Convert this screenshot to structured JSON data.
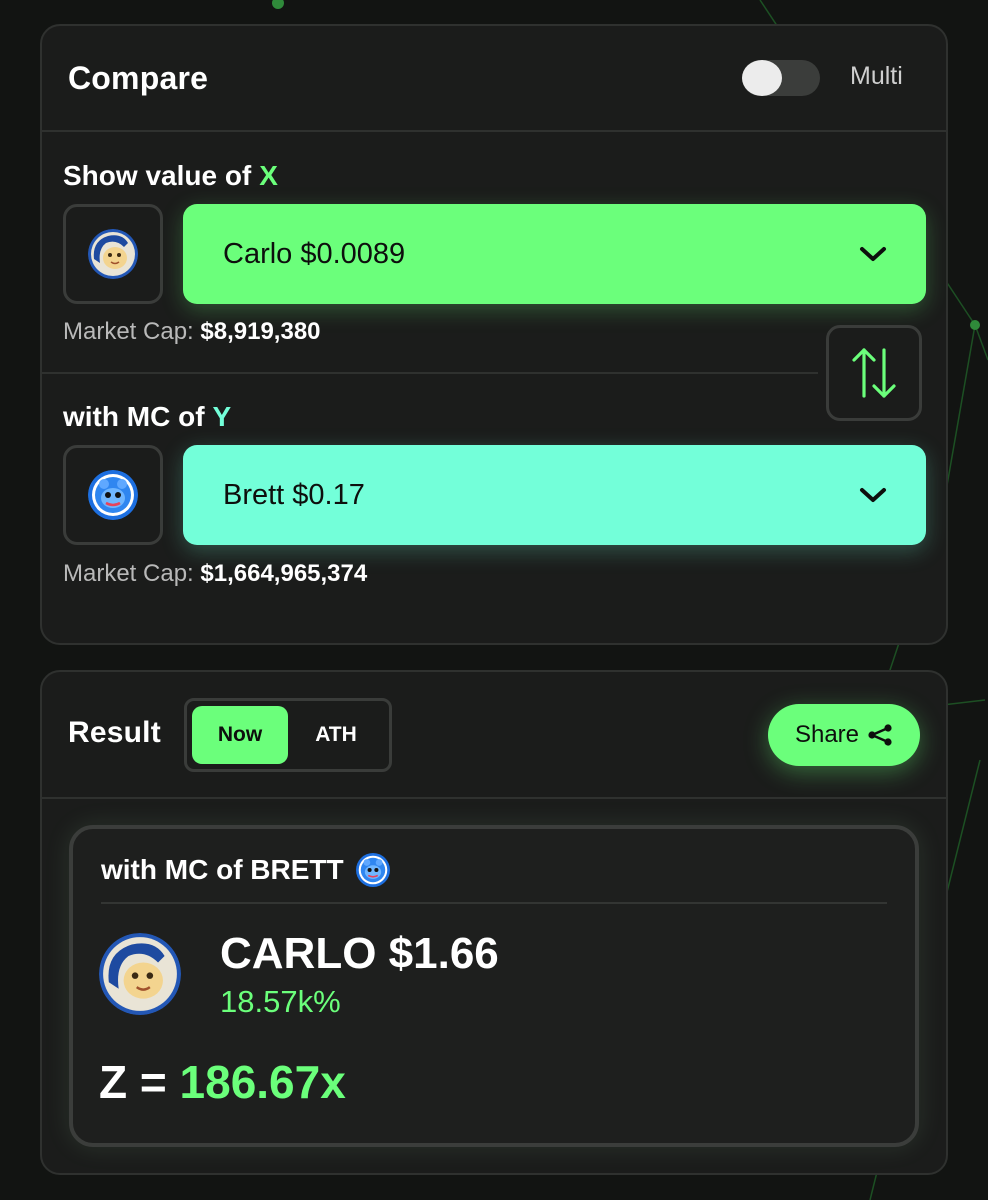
{
  "compare": {
    "title": "Compare",
    "multi_label": "Multi",
    "multi_enabled": false,
    "x_section": {
      "label": "Show value of",
      "variable": "X",
      "token_icon": "carlo-avatar",
      "selected": "Carlo $0.0089",
      "market_cap_label": "Market Cap:",
      "market_cap_value": "$8,919,380"
    },
    "y_section": {
      "label": "with MC of",
      "variable": "Y",
      "token_icon": "brett-avatar",
      "selected": "Brett $0.17",
      "market_cap_label": "Market Cap:",
      "market_cap_value": "$1,664,965,374"
    },
    "swap_icon": "swap-vertical-icon"
  },
  "result": {
    "title": "Result",
    "tabs": [
      {
        "label": "Now",
        "active": true
      },
      {
        "label": "ATH",
        "active": false
      }
    ],
    "share_label": "Share",
    "share_icon": "share-icon",
    "card": {
      "title": "with MC of BRETT",
      "title_icon": "brett-avatar",
      "token_icon": "carlo-avatar",
      "price_line": "CARLO $1.66",
      "percent": "18.57k%",
      "z_label": "Z =",
      "z_value": "186.67x"
    }
  },
  "colors": {
    "background": "#121412",
    "card": "#1b1c1b",
    "accent_green": "#6bff7b",
    "accent_teal": "#73ffd9"
  }
}
